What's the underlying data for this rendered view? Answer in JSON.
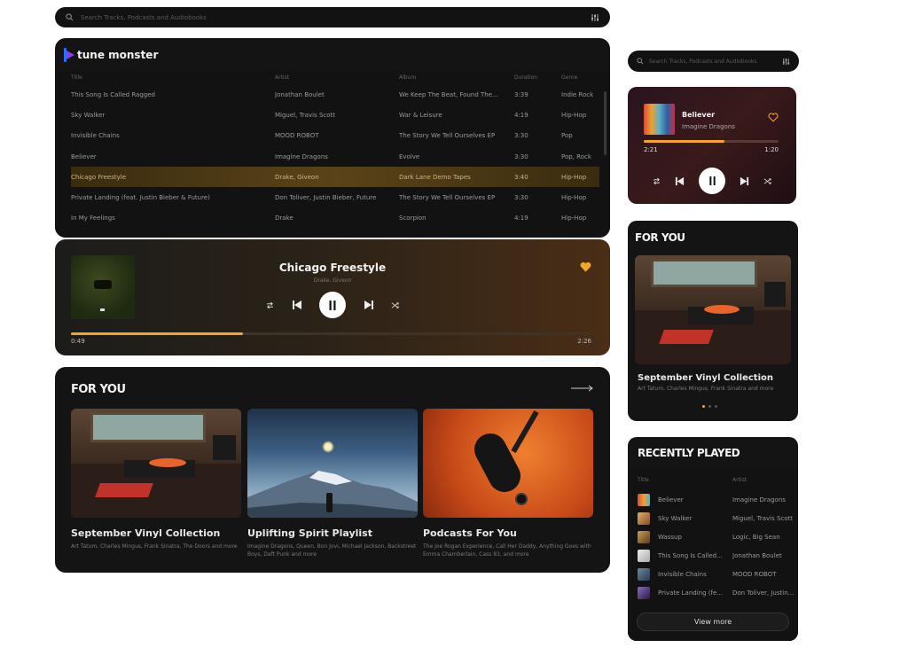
{
  "search": {
    "placeholder": "Search Tracks, Podcasts and Audiobooks"
  },
  "brand": {
    "name": "tune monster"
  },
  "table": {
    "headers": [
      "Title",
      "Artist",
      "Album",
      "Duration",
      "Genre"
    ],
    "rows": [
      {
        "title": "This Song Is Called Ragged",
        "artist": "Jonathan Boulet",
        "album": "We Keep The Beat, Found The...",
        "duration": "3:39",
        "genre": "Indie Rock"
      },
      {
        "title": "Sky Walker",
        "artist": "Miguel, Travis Scott",
        "album": "War & Leisure",
        "duration": "4:19",
        "genre": "Hip-Hop"
      },
      {
        "title": "Invisible Chains",
        "artist": "MOOD ROBOT",
        "album": "The Story We Tell Ourselves EP",
        "duration": "3:30",
        "genre": "Pop"
      },
      {
        "title": "Believer",
        "artist": "Imagine Dragons",
        "album": "Evolve",
        "duration": "3:30",
        "genre": "Pop, Rock"
      },
      {
        "title": "Chicago Freestyle",
        "artist": "Drake, Giveon",
        "album": "Dark Lane Demo Tapes",
        "duration": "3:40",
        "genre": "Hip-Hop"
      },
      {
        "title": "Private Landing (feat. Justin Bieber & Future)",
        "artist": "Don Toliver, Justin Bieber, Future",
        "album": "The Story We Tell Ourselves EP",
        "duration": "3:30",
        "genre": "Hip-Hop"
      },
      {
        "title": "In My Feelings",
        "artist": "Drake",
        "album": "Scorpion",
        "duration": "4:19",
        "genre": "Hip-Hop"
      }
    ]
  },
  "player": {
    "title": "Chicago Freestyle",
    "artist": "Drake, Giveon",
    "elapsed": "0:49",
    "total": "2:26",
    "progress": 0.33
  },
  "foryou": {
    "title": "FOR YOU",
    "cards": [
      {
        "title": "September Vinyl Collection",
        "sub": "Art Tatum, Charles Mingus, Frank Sinatra, The Doors and more"
      },
      {
        "title": "Uplifting Spirit Playlist",
        "sub": "Imagine Dragons, Queen, Bon Jovi, Michael Jackson, Backstreet Boys, Daft Punk and more"
      },
      {
        "title": "Podcasts For You",
        "sub": "The Joe Rogan Experience, Call Her Daddy, Anything Goes with Emma Chamberlain, Cass 83, and more"
      }
    ]
  },
  "mini_player": {
    "title": "Believer",
    "artist": "Imagine Dragons",
    "elapsed": "2:21",
    "remaining": "1:20",
    "progress": 0.6
  },
  "side_foryou": {
    "title": "FOR YOU",
    "card_title": "September Vinyl Collection",
    "card_sub": "Art Tatum, Charles Mingus, Frank Sinatra and more"
  },
  "recent": {
    "title": "RECENTLY PLAYED",
    "headers": [
      "Title",
      "Artist"
    ],
    "rows": [
      {
        "title": "Believer",
        "artist": "Imagine Dragons"
      },
      {
        "title": "Sky Walker",
        "artist": "Miguel, Travis Scott"
      },
      {
        "title": "Wassup",
        "artist": "Logic, Big Sean"
      },
      {
        "title": "This Song Is Called...",
        "artist": "Jonathan Boulet"
      },
      {
        "title": "Invisible Chains",
        "artist": "MOOD ROBOT"
      },
      {
        "title": "Private Landing (fe...",
        "artist": "Don Toliver, Justin..."
      }
    ],
    "view_more": "View more"
  },
  "colors": {
    "accent": "#f5a623",
    "brand_blue": "#2d6cf6",
    "brand_purple": "#8a3df0"
  }
}
